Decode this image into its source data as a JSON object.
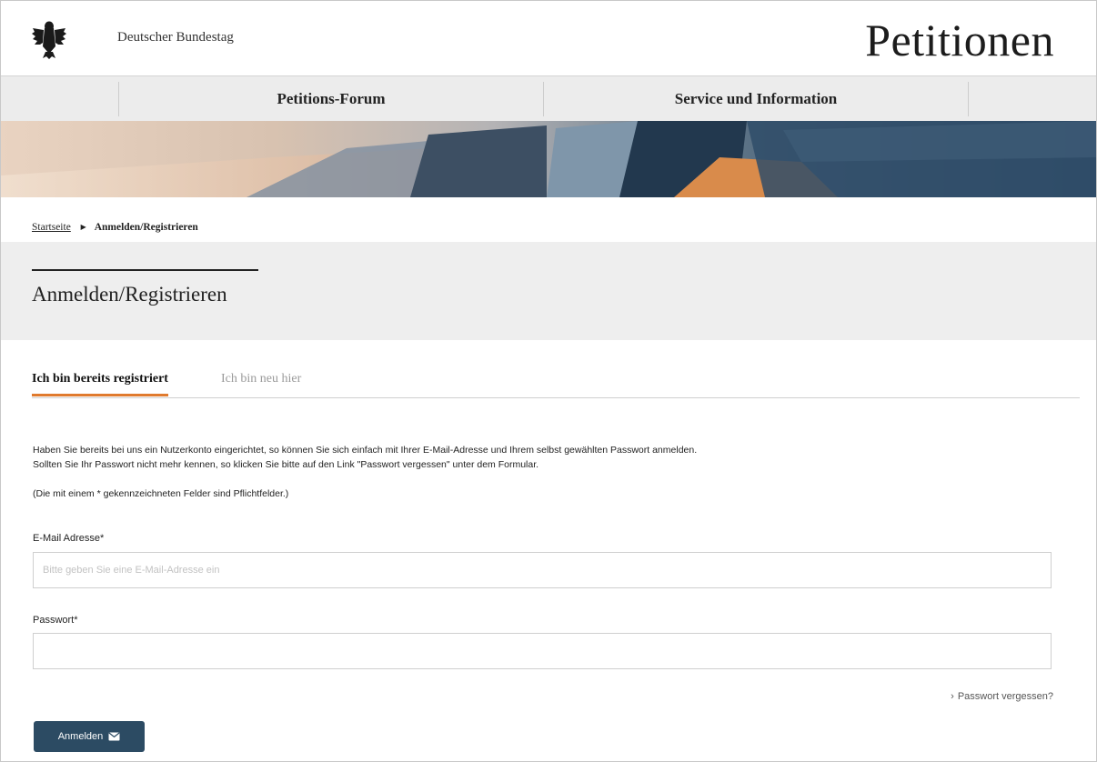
{
  "header": {
    "organization": "Deutscher Bundestag",
    "brand": "Petitionen"
  },
  "nav": {
    "items": [
      {
        "label": "Petitions-Forum"
      },
      {
        "label": "Service und Information"
      }
    ]
  },
  "breadcrumb": {
    "home": "Startseite",
    "current": "Anmelden/Registrieren"
  },
  "page": {
    "title": "Anmelden/Registrieren"
  },
  "tabs": [
    {
      "label": "Ich bin bereits registriert",
      "active": true
    },
    {
      "label": "Ich bin neu hier",
      "active": false
    }
  ],
  "intro": {
    "line1": "Haben Sie bereits bei uns ein Nutzerkonto eingerichtet, so können Sie sich einfach mit Ihrer E-Mail-Adresse und Ihrem selbst gewählten Passwort anmelden.",
    "line2": "Sollten Sie Ihr Passwort nicht mehr kennen, so klicken Sie bitte auf den Link \"Passwort vergessen\" unter dem Formular.",
    "required_note": "(Die mit einem * gekennzeichneten Felder sind Pflichtfelder.)"
  },
  "form": {
    "email": {
      "label": "E-Mail Adresse*",
      "placeholder": "Bitte geben Sie eine E-Mail-Adresse ein",
      "value": ""
    },
    "password": {
      "label": "Passwort*",
      "value": ""
    },
    "forgot_link": "Passwort vergessen?",
    "submit_label": "Anmelden"
  },
  "colors": {
    "accent": "#e07a2e",
    "button": "#2c4b63",
    "nav_bg": "#ececec",
    "title_band": "#eeeeee"
  },
  "icons": {
    "logo": "federal-eagle-icon",
    "breadcrumb_separator": "triangle-right-icon",
    "forgot_link": "chevron-right-icon",
    "submit": "envelope-icon"
  }
}
